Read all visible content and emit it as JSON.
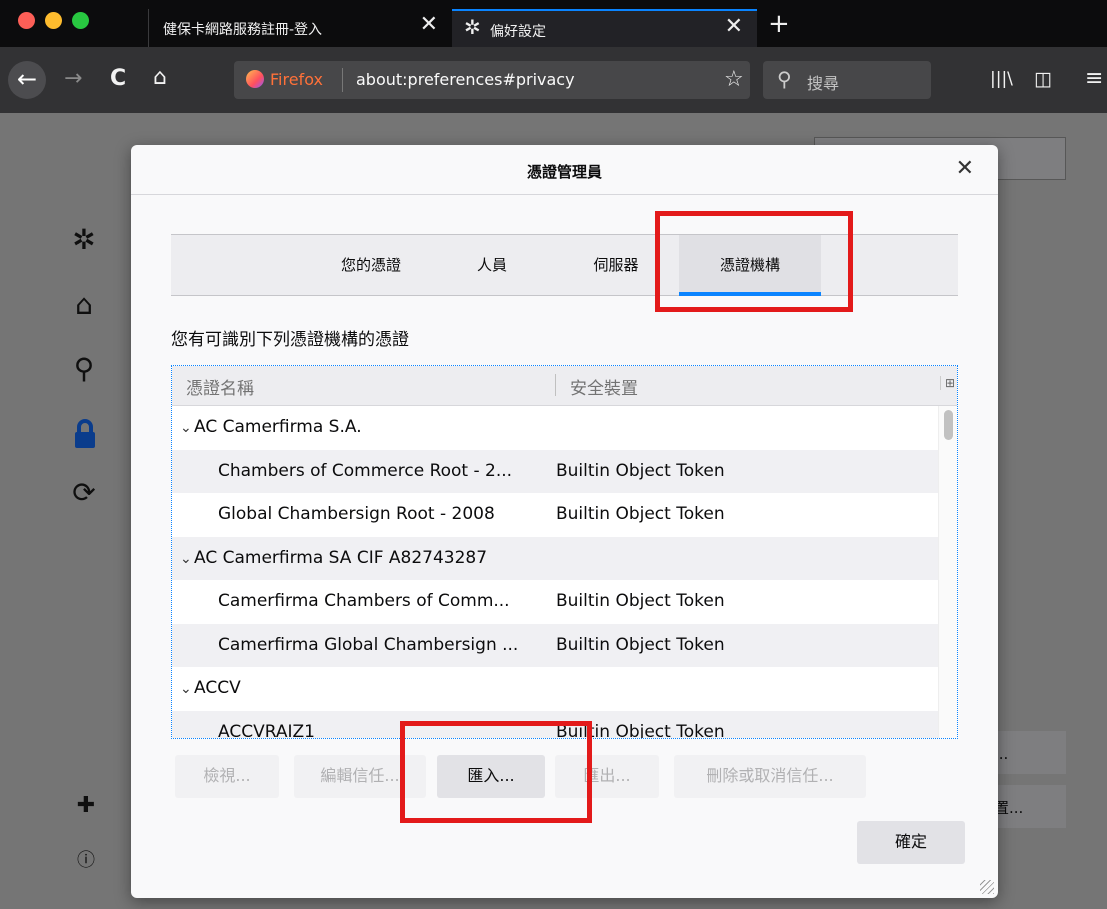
{
  "tabs": [
    {
      "title": "健保卡網路服務註冊-登入",
      "close": "✕"
    },
    {
      "title": "偏好設定",
      "icon": "gear-icon",
      "close": "✕"
    }
  ],
  "new_tab": "+",
  "nav": {
    "back": "←",
    "forward": "→",
    "reload": "C",
    "home": "⌂",
    "identity": "Firefox",
    "url": "about:preferences#privacy",
    "bookmark_star": "☆",
    "search_placeholder": "搜尋",
    "search_glyph": "⚲",
    "library": "|||\\",
    "sidebar_toggle": "◫",
    "menu": "≡"
  },
  "background_page": {
    "button_1_suffix": "...",
    "button_2_suffix": "置..."
  },
  "left_sidebar_icons": [
    "gear-icon",
    "home-icon",
    "search-icon",
    "lock-icon",
    "sync-icon",
    "extensions-icon",
    "help-icon"
  ],
  "dialog": {
    "title": "憑證管理員",
    "close": "✕",
    "tabs": [
      {
        "label": "您的憑證",
        "active": false
      },
      {
        "label": "人員",
        "active": false
      },
      {
        "label": "伺服器",
        "active": false
      },
      {
        "label": "憑證機構",
        "active": true
      }
    ],
    "description": "您有可識別下列憑證機構的憑證",
    "columns": {
      "name": "憑證名稱",
      "device": "安全裝置",
      "picker": "⊞"
    },
    "rows": [
      {
        "name": "AC Camerfirma S.A.",
        "token": "",
        "group": true
      },
      {
        "name": "Chambers of Commerce Root - 2...",
        "token": "Builtin Object Token",
        "group": false
      },
      {
        "name": "Global Chambersign Root - 2008",
        "token": "Builtin Object Token",
        "group": false
      },
      {
        "name": "AC Camerfirma SA CIF A82743287",
        "token": "",
        "group": true
      },
      {
        "name": "Camerfirma Chambers of Comm...",
        "token": "Builtin Object Token",
        "group": false
      },
      {
        "name": "Camerfirma Global Chambersign ...",
        "token": "Builtin Object Token",
        "group": false
      },
      {
        "name": "ACCV",
        "token": "",
        "group": true
      },
      {
        "name": "ACCVRAIZ1",
        "token": "Builtin Object Token",
        "group": false
      }
    ],
    "buttons": {
      "view": "檢視...",
      "edit_trust": "編輯信任...",
      "import": "匯入...",
      "export": "匯出...",
      "delete": "刪除或取消信任..."
    },
    "ok": "確定"
  },
  "colors": {
    "accent": "#0a84ff",
    "highlight": "#e31a1a",
    "firefox_label": "#ff7139"
  }
}
